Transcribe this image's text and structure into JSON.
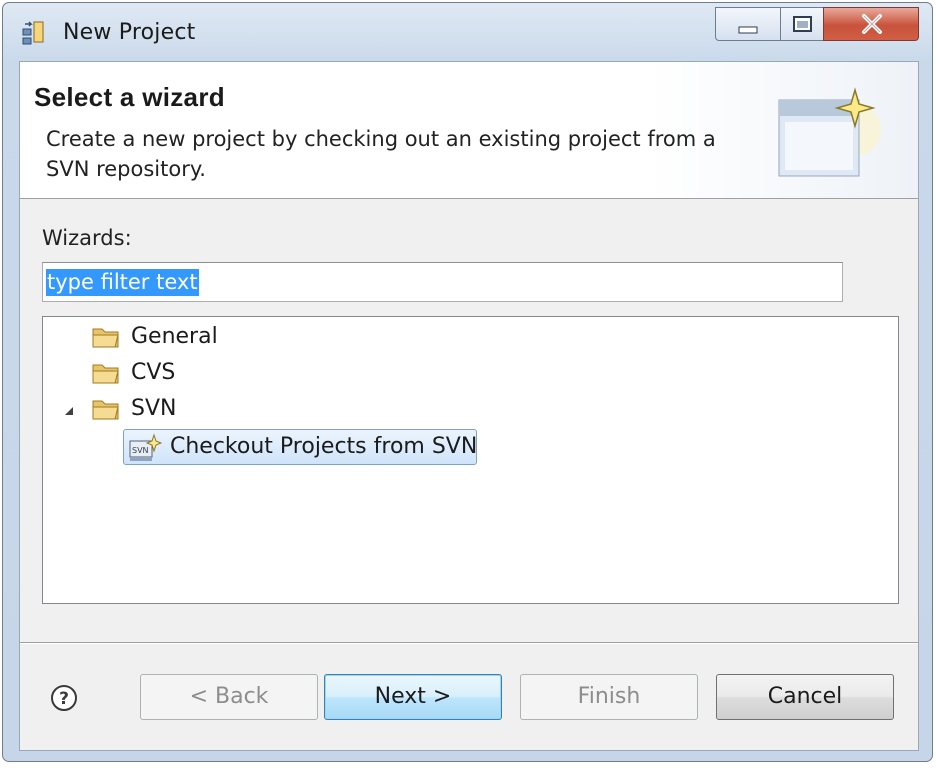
{
  "window": {
    "title": "New Project"
  },
  "banner": {
    "title": "Select a wizard",
    "description": "Create a new project by checking out an existing project from a SVN repository."
  },
  "wizards": {
    "label": "Wizards:",
    "filter_value": "type filter text"
  },
  "tree": {
    "items": [
      {
        "label": "General",
        "icon": "folder-icon"
      },
      {
        "label": "CVS",
        "icon": "folder-icon"
      },
      {
        "label": "SVN",
        "icon": "folder-icon",
        "expanded": true,
        "children": [
          {
            "label": "Checkout Projects from SVN",
            "icon": "svn-checkout-wizard-icon",
            "selected": true
          }
        ]
      }
    ]
  },
  "buttons": {
    "back": "< Back",
    "next": "Next >",
    "finish": "Finish",
    "cancel": "Cancel"
  },
  "colors": {
    "selection": "#3399ff",
    "default_button": "#3c7fb1",
    "close_button": "#c9523c"
  }
}
